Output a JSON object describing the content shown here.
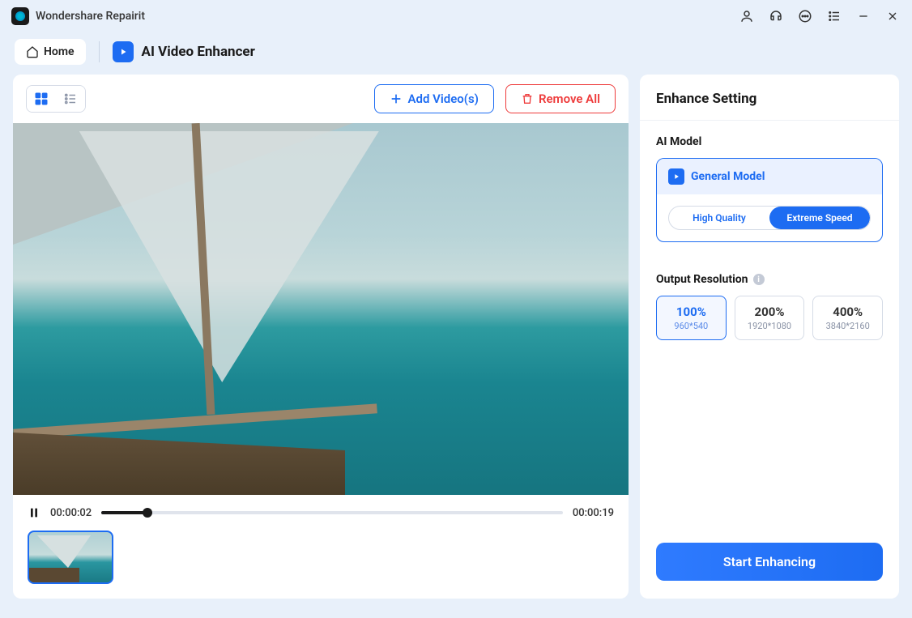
{
  "app": {
    "title": "Wondershare Repairit"
  },
  "nav": {
    "home": "Home",
    "page_title": "AI Video Enhancer"
  },
  "toolbar": {
    "add": "Add Video(s)",
    "remove": "Remove All"
  },
  "playback": {
    "current": "00:00:02",
    "duration": "00:00:19"
  },
  "enhance": {
    "title": "Enhance Setting",
    "ai_model_label": "AI Model",
    "model_name": "General Model",
    "mode_hq": "High Quality",
    "mode_speed": "Extreme Speed",
    "output_label": "Output Resolution",
    "resolutions": [
      {
        "pct": "100%",
        "dim": "960*540"
      },
      {
        "pct": "200%",
        "dim": "1920*1080"
      },
      {
        "pct": "400%",
        "dim": "3840*2160"
      }
    ],
    "start": "Start Enhancing"
  }
}
